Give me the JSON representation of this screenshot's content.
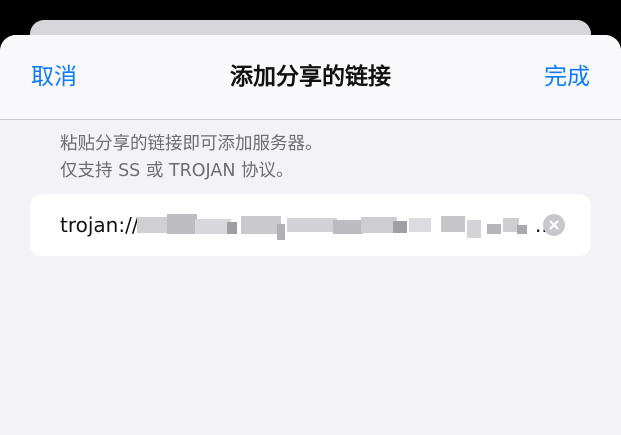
{
  "nav": {
    "cancel_label": "取消",
    "title": "添加分享的链接",
    "done_label": "完成"
  },
  "hint": {
    "line1": "粘贴分享的链接即可添加服务器。",
    "line2": "仅支持 SS 或 TROJAN 协议。"
  },
  "link_field": {
    "value_prefix": "trojan://",
    "value_masked": true,
    "truncation": ".."
  },
  "colors": {
    "accent": "#0a7aff",
    "background": "#f2f2f7",
    "field": "#ffffff",
    "secondary_text": "#6d6d72"
  },
  "icons": {
    "clear": "clear-circle-icon"
  }
}
